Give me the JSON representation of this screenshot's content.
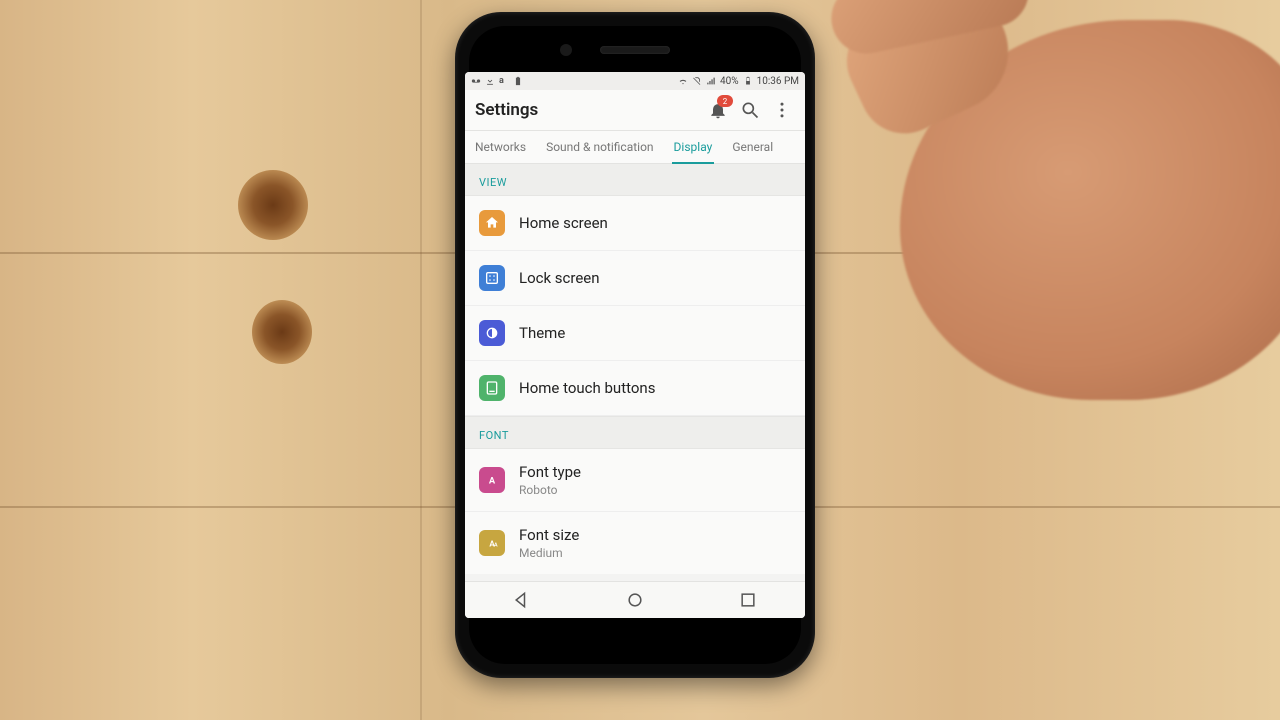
{
  "statusbar": {
    "left_icons": [
      "voicemail-icon",
      "download-icon",
      "a-icon",
      "battery-small-icon"
    ],
    "signal_label": "40%",
    "time": "10:36 PM"
  },
  "appbar": {
    "title": "Settings",
    "notifications_badge": "2"
  },
  "tabs": [
    {
      "id": "networks",
      "label": "Networks",
      "active": false
    },
    {
      "id": "sound",
      "label": "Sound & notification",
      "active": false
    },
    {
      "id": "display",
      "label": "Display",
      "active": true
    },
    {
      "id": "general",
      "label": "General",
      "active": false
    }
  ],
  "sections": [
    {
      "id": "view",
      "header": "VIEW",
      "items": [
        {
          "id": "home-screen",
          "label": "Home screen",
          "icon": "home-icon",
          "icon_color": "ic-orange"
        },
        {
          "id": "lock-screen",
          "label": "Lock screen",
          "icon": "lock-grid-icon",
          "icon_color": "ic-blue"
        },
        {
          "id": "theme",
          "label": "Theme",
          "icon": "theme-icon",
          "icon_color": "ic-indigo"
        },
        {
          "id": "home-touch",
          "label": "Home touch buttons",
          "icon": "touch-buttons-icon",
          "icon_color": "ic-green"
        }
      ]
    },
    {
      "id": "font",
      "header": "FONT",
      "items": [
        {
          "id": "font-type",
          "label": "Font type",
          "sub": "Roboto",
          "icon": "font-a-icon",
          "icon_color": "ic-pink"
        },
        {
          "id": "font-size",
          "label": "Font size",
          "sub": "Medium",
          "icon": "font-size-icon",
          "icon_color": "ic-olive"
        }
      ]
    }
  ],
  "navbar": {
    "back": "Back",
    "home": "Home",
    "recents": "Recents"
  }
}
